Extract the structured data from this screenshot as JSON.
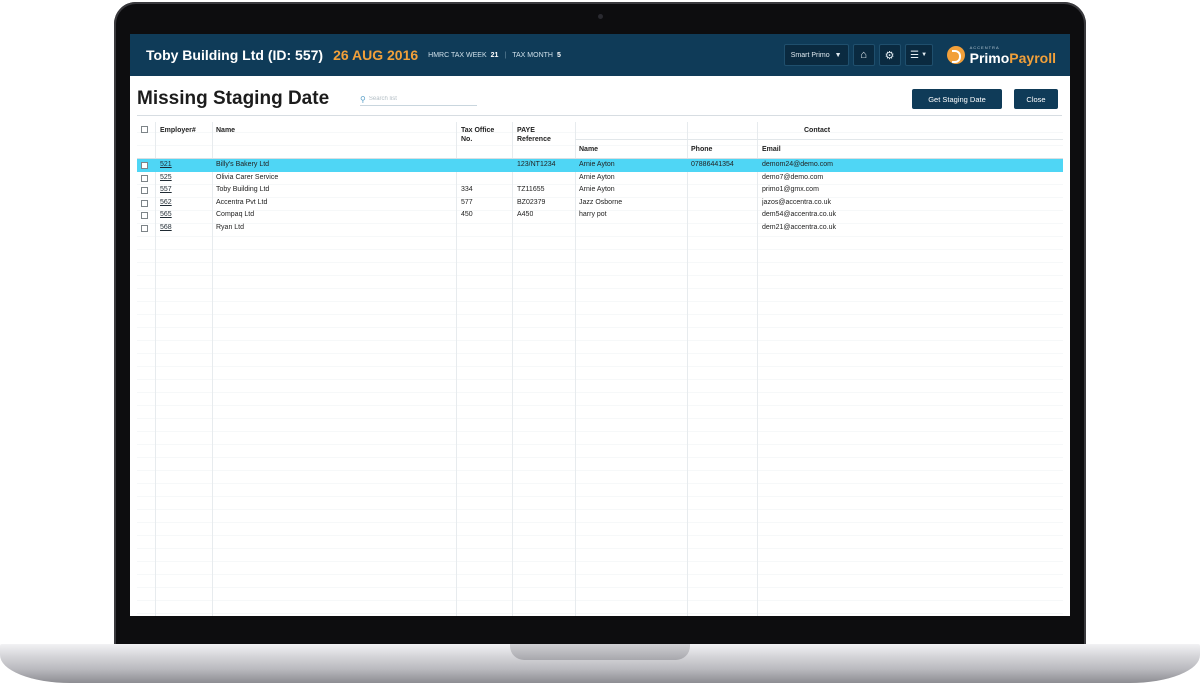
{
  "header": {
    "company": "Toby Building Ltd (ID: 557)",
    "date": "26 AUG 2016",
    "tax_week_label": "HMRC TAX WEEK",
    "tax_week_value": "21",
    "tax_month_label": "TAX MONTH",
    "tax_month_value": "5",
    "smart_primo_label": "Smart Primo",
    "home_icon": "home-icon",
    "settings_icon": "gear-icon",
    "menu_icon": "hamburger-menu-icon",
    "logo_small": "ACCENTRA",
    "logo_primo": "Primo",
    "logo_payroll": "Payroll"
  },
  "page": {
    "title": "Missing Staging Date",
    "search_placeholder": "Search list",
    "get_staging_label": "Get Staging Date",
    "close_label": "Close"
  },
  "table": {
    "columns": {
      "employer": "Employer#",
      "name": "Name",
      "tax_office_1": "Tax Office",
      "tax_office_2": "No.",
      "paye_1": "PAYE",
      "paye_2": "Reference",
      "contact": "Contact",
      "contact_name": "Name",
      "phone": "Phone",
      "email": "Email"
    },
    "rows": [
      {
        "id": "521",
        "name": "Billy's Bakery Ltd",
        "tax_office": "",
        "paye": "123/NT1234",
        "contact_name": "Arnie Ayton",
        "phone": "07886441354",
        "email": "demom24@demo.com",
        "selected": true
      },
      {
        "id": "525",
        "name": "Olivia Carer Service",
        "tax_office": "",
        "paye": "",
        "contact_name": "Arnie Ayton",
        "phone": "",
        "email": "demo7@demo.com",
        "selected": false
      },
      {
        "id": "557",
        "name": "Toby Building Ltd",
        "tax_office": "334",
        "paye": "TZ11655",
        "contact_name": "Arnie Ayton",
        "phone": "",
        "email": "primo1@gmx.com",
        "selected": false
      },
      {
        "id": "562",
        "name": "Accentra Pvt Ltd",
        "tax_office": "577",
        "paye": "BZ02379",
        "contact_name": "Jazz Osborne",
        "phone": "",
        "email": "jazos@accentra.co.uk",
        "selected": false
      },
      {
        "id": "565",
        "name": "Compaq Ltd",
        "tax_office": "450",
        "paye": "A450",
        "contact_name": "harry pot",
        "phone": "",
        "email": "dem54@accentra.co.uk",
        "selected": false
      },
      {
        "id": "568",
        "name": "Ryan Ltd",
        "tax_office": "",
        "paye": "",
        "contact_name": "",
        "phone": "",
        "email": "dem21@accentra.co.uk",
        "selected": false
      }
    ]
  },
  "colors": {
    "header_bg": "#0f3b58",
    "date_accent": "#f2a03a",
    "selected_row": "#4fd6f5",
    "button_bg": "#0f3b58"
  }
}
